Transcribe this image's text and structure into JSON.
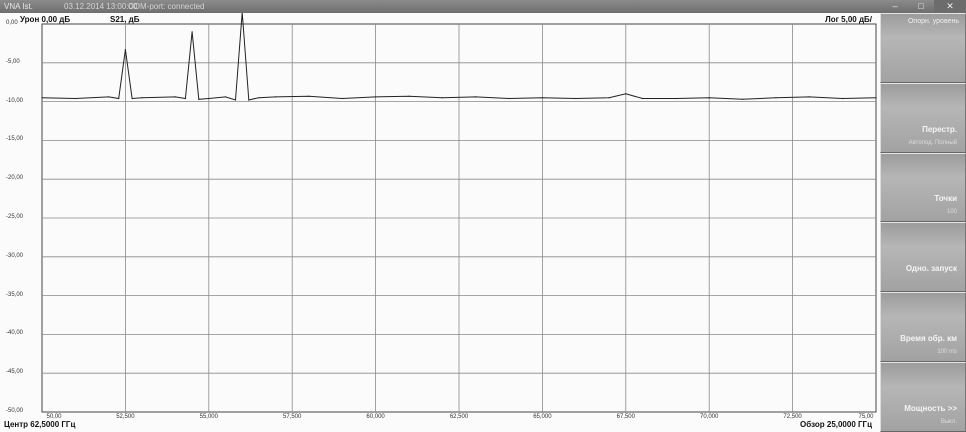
{
  "window": {
    "title": "VNA Ist.",
    "title_extra_1": "03.12.2014 13:00:00",
    "title_extra_2": "COM-port: connected"
  },
  "header": {
    "ref_level": "Урон 0,00 дБ",
    "measurement": "S21, дБ",
    "scale": "Лог 5,00 дБ/"
  },
  "footer": {
    "center": "Центр 62,5000 ГГц",
    "span": "Обзор 25,0000 ГГц"
  },
  "softkeys": {
    "top_label": "Опорн. уровень",
    "restart_label": "Перестр.",
    "restart_sub": "Автопод. Полный",
    "points_label": "Точки",
    "points_value": "100",
    "single_label": "Одно. запуск",
    "sweep_time_label": "Время обр. км",
    "sweep_time_value": "100 ms",
    "power_label": "Мощность >>",
    "power_value": "Выкл."
  },
  "chart_data": {
    "type": "line",
    "title": "",
    "xlabel": "",
    "ylabel": "",
    "x_ticks": [
      "50,00",
      "52,500",
      "55,000",
      "57,500",
      "60,000",
      "62,500",
      "65,000",
      "67,500",
      "70,000",
      "72,500",
      "75,00"
    ],
    "y_ticks": [
      "0,00",
      "-5,00",
      "-10,00",
      "-15,00",
      "-20,00",
      "-25,00",
      "-30,00",
      "-35,00",
      "-40,00",
      "-45,00",
      "-50,00"
    ],
    "xlim": [
      50.0,
      75.0
    ],
    "ylim": [
      -50.0,
      0.0
    ],
    "grid": true,
    "series": [
      {
        "x": [
          50.0,
          51.0,
          52.0,
          52.3,
          52.5,
          52.7,
          53.0,
          54.0,
          54.3,
          54.5,
          54.7,
          55.0,
          55.5,
          55.8,
          56.0,
          56.2,
          56.5,
          57.0,
          58.0,
          59.0,
          60.0,
          61.0,
          62.0,
          63.0,
          64.0,
          65.0,
          66.0,
          67.0,
          67.5,
          68.0,
          69.0,
          70.0,
          71.0,
          72.0,
          73.0,
          74.0,
          75.0
        ],
        "y": [
          -9.5,
          -9.6,
          -9.4,
          -9.6,
          -3.3,
          -9.6,
          -9.5,
          -9.4,
          -9.6,
          -1.0,
          -9.7,
          -9.6,
          -9.4,
          -9.8,
          1.5,
          -9.8,
          -9.5,
          -9.4,
          -9.3,
          -9.6,
          -9.4,
          -9.3,
          -9.5,
          -9.4,
          -9.6,
          -9.5,
          -9.6,
          -9.5,
          -9.0,
          -9.6,
          -9.6,
          -9.5,
          -9.7,
          -9.5,
          -9.4,
          -9.6,
          -9.5
        ]
      }
    ]
  }
}
